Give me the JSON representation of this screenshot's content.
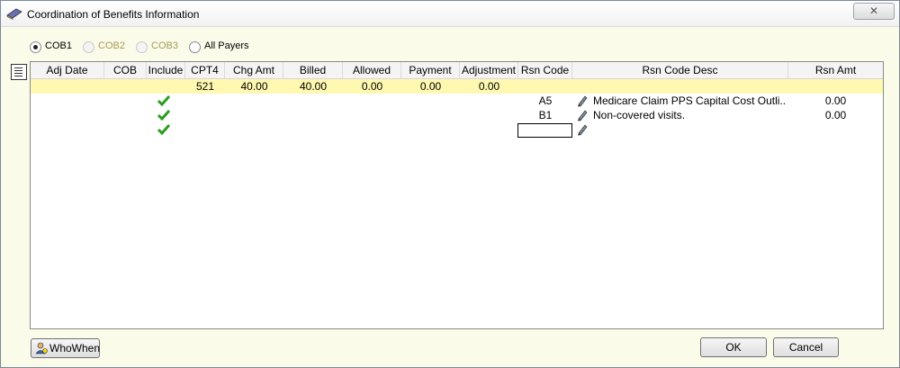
{
  "window": {
    "title": "Coordination of Benefits Information",
    "close_label": "✕"
  },
  "payer_options": [
    {
      "label": "COB1",
      "checked": true,
      "disabled": false
    },
    {
      "label": "COB2",
      "checked": false,
      "disabled": true
    },
    {
      "label": "COB3",
      "checked": false,
      "disabled": true
    },
    {
      "label": "All Payers",
      "checked": false,
      "disabled": false
    }
  ],
  "grid": {
    "columns": [
      "Adj Date",
      "COB",
      "Include",
      "CPT4",
      "Chg Amt",
      "Billed",
      "Allowed",
      "Payment",
      "Adjustment",
      "Rsn Code",
      "Rsn Code Desc",
      "Rsn Amt"
    ],
    "main_row": {
      "cpt4": "521",
      "chg_amt": "40.00",
      "billed": "40.00",
      "allowed": "0.00",
      "payment": "0.00",
      "adjustment": "0.00"
    },
    "reason_rows": [
      {
        "rsn_code": "A5",
        "rsn_desc": "Medicare Claim PPS Capital Cost Outli...",
        "rsn_amt": "0.00",
        "included": true
      },
      {
        "rsn_code": "B1",
        "rsn_desc": "Non-covered visits.",
        "rsn_amt": "0.00",
        "included": true
      },
      {
        "rsn_code": "",
        "rsn_desc": "",
        "rsn_amt": "",
        "included": true
      }
    ]
  },
  "footer": {
    "who_when_label": "WhoWhen",
    "ok_label": "OK",
    "cancel_label": "Cancel"
  },
  "colors": {
    "highlight_row": "#fff8b0",
    "window_bg": "#fbfbea",
    "check": "#2a9d1e"
  }
}
